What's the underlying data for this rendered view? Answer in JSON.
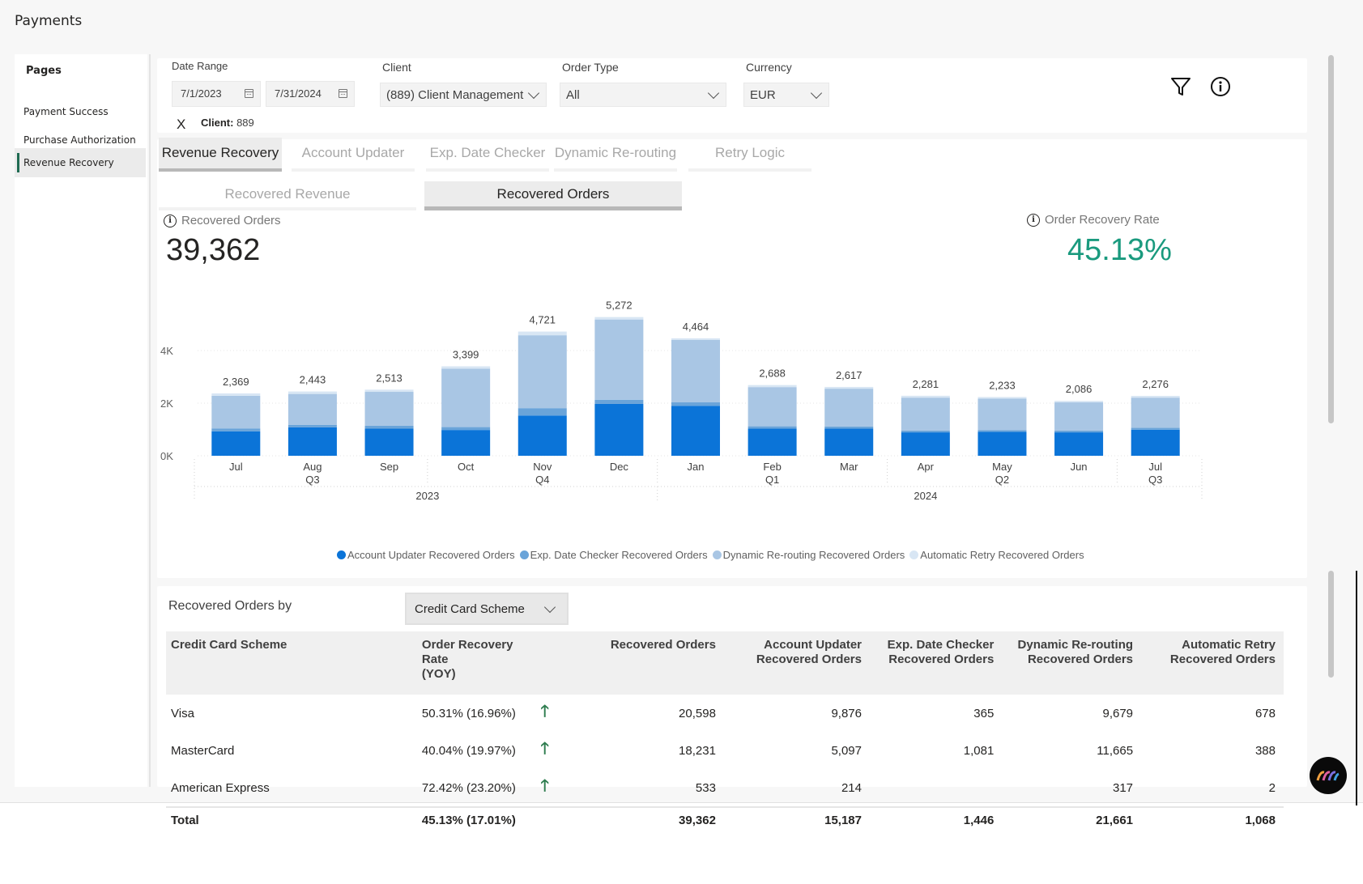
{
  "app": {
    "title": "Payments"
  },
  "sidebar": {
    "title": "Pages",
    "items": [
      {
        "label": "Payment Success",
        "active": false
      },
      {
        "label": "Purchase Authorization",
        "active": false
      },
      {
        "label": "Revenue Recovery",
        "active": true
      }
    ]
  },
  "filters": {
    "date_range_label": "Date Range",
    "date_start": "7/1/2023",
    "date_end": "7/31/2024",
    "client_label": "Client",
    "client_value": "(889) Client Management",
    "order_type_label": "Order Type",
    "order_type_value": "All",
    "currency_label": "Currency",
    "currency_value": "EUR",
    "clear_label": "X",
    "chip_key": "Client:",
    "chip_value": "889"
  },
  "tabs": [
    {
      "label": "Revenue Recovery",
      "active": true
    },
    {
      "label": "Account Updater",
      "active": false
    },
    {
      "label": "Exp. Date Checker",
      "active": false
    },
    {
      "label": "Dynamic Re-routing",
      "active": false
    },
    {
      "label": "Retry Logic",
      "active": false
    }
  ],
  "subtabs": [
    {
      "label": "Recovered Revenue",
      "active": false
    },
    {
      "label": "Recovered Orders",
      "active": true
    }
  ],
  "kpis": {
    "recovered_orders_label": "Recovered Orders",
    "recovered_orders_value": "39,362",
    "recovery_rate_label": "Order Recovery Rate",
    "recovery_rate_value": "45.13%",
    "recovery_rate_color": "#1a9a7e"
  },
  "chart_data": {
    "type": "bar",
    "stacked": true,
    "title": "",
    "xlabel": "",
    "ylabel": "",
    "ylim": [
      0,
      5500
    ],
    "yticks": [
      0,
      2000,
      4000
    ],
    "ytick_labels": [
      "0K",
      "2K",
      "4K"
    ],
    "grid": true,
    "legend_position": "bottom",
    "categories": [
      "Jul",
      "Aug",
      "Sep",
      "Oct",
      "Nov",
      "Dec",
      "Jan",
      "Feb",
      "Mar",
      "Apr",
      "May",
      "Jun",
      "Jul"
    ],
    "quarter_labels": [
      {
        "label": "Q3",
        "index": 1
      },
      {
        "label": "Q4",
        "index": 4
      },
      {
        "label": "Q1",
        "index": 7
      },
      {
        "label": "Q2",
        "index": 10
      },
      {
        "label": "Q3",
        "index": 12
      }
    ],
    "year_labels": [
      {
        "label": "2023",
        "from": 0,
        "to": 5
      },
      {
        "label": "2024",
        "from": 6,
        "to": 12
      }
    ],
    "totals": [
      2369,
      2443,
      2513,
      3399,
      4721,
      5272,
      4464,
      2688,
      2617,
      2281,
      2233,
      2086,
      2276
    ],
    "total_labels": [
      "2,369",
      "2,443",
      "2,513",
      "3,399",
      "4,721",
      "5,272",
      "4,464",
      "2,688",
      "2,617",
      "2,281",
      "2,233",
      "2,086",
      "2,276"
    ],
    "series": [
      {
        "name": "Account Updater Recovered Orders",
        "color": "#0b74d8",
        "values": [
          930,
          1080,
          1030,
          980,
          1530,
          1970,
          1900,
          1030,
          1030,
          890,
          910,
          890,
          990
        ]
      },
      {
        "name": "Exp. Date Checker Recovered Orders",
        "color": "#6aa4d9",
        "values": [
          110,
          90,
          110,
          110,
          280,
          160,
          130,
          90,
          80,
          70,
          60,
          70,
          70
        ]
      },
      {
        "name": "Dynamic Re-routing Recovered Orders",
        "color": "#a9c6e4",
        "values": [
          1240,
          1180,
          1290,
          2220,
          2770,
          3050,
          2370,
          1490,
          1440,
          1250,
          1200,
          1070,
          1150
        ]
      },
      {
        "name": "Automatic Retry Recovered Orders",
        "color": "#d8e6f4",
        "values": [
          89,
          93,
          83,
          89,
          141,
          92,
          64,
          78,
          67,
          71,
          63,
          56,
          66
        ]
      }
    ]
  },
  "table": {
    "title": "Recovered Orders by",
    "group_by_value": "Credit Card Scheme",
    "columns": [
      "Credit Card Scheme",
      "Order Recovery Rate (YOY)",
      "",
      "Recovered Orders",
      "Account Updater Recovered Orders",
      "Exp. Date Checker Recovered Orders",
      "Dynamic Re-routing Recovered Orders",
      "Automatic Retry Recovered Orders"
    ],
    "column_headers_lines": [
      [
        "Credit Card Scheme",
        ""
      ],
      [
        "Order Recovery Rate",
        "(YOY)"
      ],
      [
        "",
        ""
      ],
      [
        "Recovered Orders",
        ""
      ],
      [
        "Account Updater",
        "Recovered Orders"
      ],
      [
        "Exp. Date Checker",
        "Recovered Orders"
      ],
      [
        "Dynamic Re-routing",
        "Recovered Orders"
      ],
      [
        "Automatic Retry",
        "Recovered Orders"
      ]
    ],
    "rows": [
      {
        "scheme": "Visa",
        "rate": "50.31% (16.96%)",
        "trend": "up",
        "recovered": "20,598",
        "account_updater": "9,876",
        "exp_date": "365",
        "dynamic": "9,679",
        "retry": "678"
      },
      {
        "scheme": "MasterCard",
        "rate": "40.04% (19.97%)",
        "trend": "up",
        "recovered": "18,231",
        "account_updater": "5,097",
        "exp_date": "1,081",
        "dynamic": "11,665",
        "retry": "388"
      },
      {
        "scheme": "American Express",
        "rate": "72.42% (23.20%)",
        "trend": "up",
        "recovered": "533",
        "account_updater": "214",
        "exp_date": "",
        "dynamic": "317",
        "retry": "2"
      }
    ],
    "total": {
      "scheme": "Total",
      "rate": "45.13% (17.01%)",
      "recovered": "39,362",
      "account_updater": "15,187",
      "exp_date": "1,446",
      "dynamic": "21,661",
      "retry": "1,068"
    },
    "trend_up_glyph": "🡑",
    "trend_color": "#2e7d4f"
  }
}
